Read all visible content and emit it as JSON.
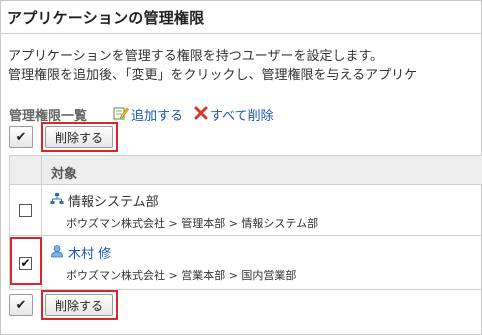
{
  "page": {
    "title": "アプリケーションの管理権限",
    "description_line1": "アプリケーションを管理する権限を持つユーザーを設定します。",
    "description_line2": "管理権限を追加後、「変更」をクリックし、管理権限を与えるアプリケ"
  },
  "toolbar": {
    "list_title": "管理権限一覧",
    "add_label": "追加する",
    "delete_all_label": "すべて削除"
  },
  "bulk_actions": {
    "check_all_glyph": "✔",
    "delete_button_label": "削除する"
  },
  "table": {
    "header_target": "対象",
    "rows": [
      {
        "type": "organization",
        "icon": "org-chart-icon",
        "name": "情報システム部",
        "path": "ボウズマン株式会社 > 管理本部 > 情報システム部",
        "checked": false
      },
      {
        "type": "user",
        "icon": "user-icon",
        "name": "木村 修",
        "path": "ボウズマン株式会社 > 営業本部 > 国内営業部",
        "checked": true
      }
    ]
  },
  "colors": {
    "highlight": "#d9262b",
    "link": "#1a56b3"
  }
}
